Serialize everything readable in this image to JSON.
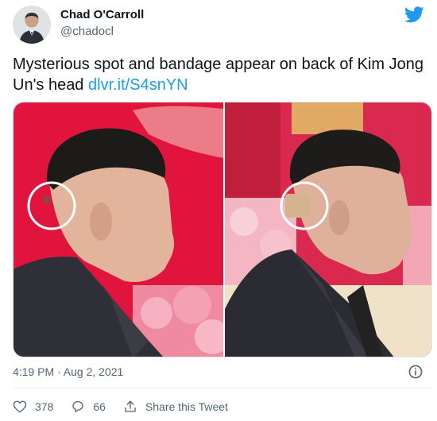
{
  "author": {
    "name": "Chad O'Carroll",
    "handle": "@chadocl"
  },
  "tweet": {
    "text": "Mysterious spot and bandage appear on back of Kim Jong Un's head",
    "link": "dlvr.it/S4snYN"
  },
  "meta": {
    "timestamp": "4:19 PM · Aug 2, 2021"
  },
  "actions": {
    "likes": "378",
    "replies": "66",
    "share": "Share this Tweet"
  },
  "icons": {
    "brand": "twitter-bird-icon",
    "info": "info-icon",
    "like": "heart-icon",
    "reply": "reply-bubble-icon",
    "share": "share-icon"
  },
  "colors": {
    "brand": "#1d9bf0",
    "text": "#0f1419",
    "muted": "#536471"
  }
}
